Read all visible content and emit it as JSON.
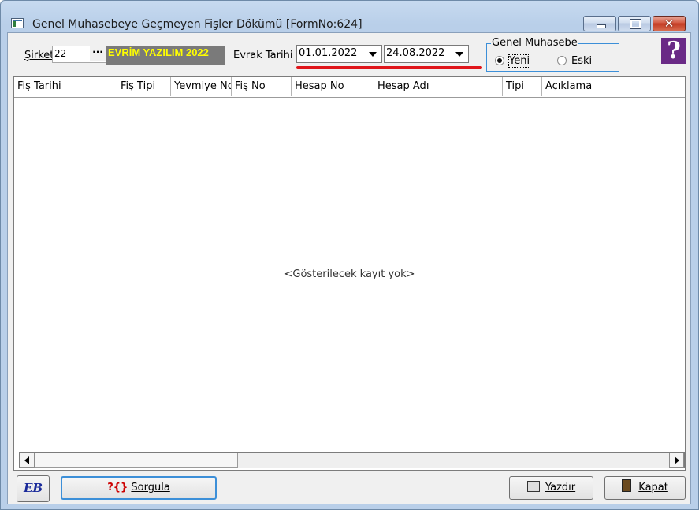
{
  "window": {
    "title": "Genel Muhasebeye Geçmeyen Fişler Dökümü [FormNo:624]",
    "controls": {
      "minimize": "—",
      "maximize": "☐",
      "close": "✕"
    }
  },
  "filters": {
    "company_label": "Şirket",
    "company_code": "22",
    "company_lookup": "···",
    "company_name": "EVRİM YAZILIM  2022",
    "date_label": "Evrak Tarihi",
    "date_from": "01.01.2022",
    "date_to": "24.08.2022",
    "ledger_group": {
      "title": "Genel Muhasebe",
      "options": [
        {
          "label": "Yeni",
          "selected": true
        },
        {
          "label": "Eski",
          "selected": false
        }
      ]
    },
    "help": "?"
  },
  "grid": {
    "columns": [
      "Fiş Tarihi",
      "Fiş Tipi",
      "Yevmiye No",
      "Fiş No",
      "Hesap No",
      "Hesap Adı",
      "Tipi",
      "Açıklama"
    ],
    "rows": [],
    "empty_message": "<Gösterilecek kayıt yok>"
  },
  "footer": {
    "logo": "EB",
    "query_button": "Sorgula",
    "query_icon": "?{}",
    "print_button": "Yazdır",
    "close_button": "Kapat"
  },
  "colors": {
    "accent": "#3c8fd8",
    "highlight": "#e0161b",
    "company_banner_bg": "#7a7a7a",
    "company_banner_text": "#ffff00"
  }
}
